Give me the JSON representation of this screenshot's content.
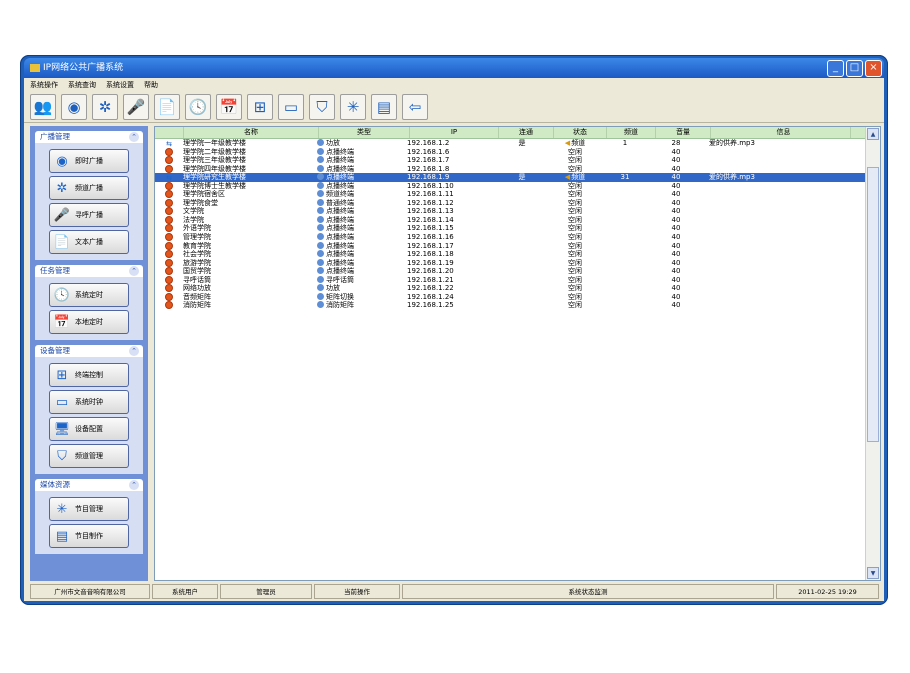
{
  "window": {
    "title": "IP网络公共广播系统"
  },
  "menu": [
    "系统操作",
    "系统查询",
    "系统设置",
    "帮助"
  ],
  "toolbar": [
    {
      "name": "users-icon",
      "glyph": "👥"
    },
    {
      "name": "record-icon",
      "glyph": "◉"
    },
    {
      "name": "snowflake-icon",
      "glyph": "✲"
    },
    {
      "name": "microphone-icon",
      "glyph": "🎤"
    },
    {
      "name": "document-icon",
      "glyph": "📄"
    },
    {
      "name": "clock-icon",
      "glyph": "🕓"
    },
    {
      "name": "schedule-icon",
      "glyph": "📅"
    },
    {
      "name": "network-icon",
      "glyph": "⊞"
    },
    {
      "name": "monitor-icon",
      "glyph": "▭"
    },
    {
      "name": "antenna-icon",
      "glyph": "⛉"
    },
    {
      "name": "burst-icon",
      "glyph": "✳"
    },
    {
      "name": "film-icon",
      "glyph": "▤"
    },
    {
      "name": "exit-icon",
      "glyph": "⇦"
    }
  ],
  "sidebar": {
    "panels": [
      {
        "title": "广播管理",
        "items": [
          {
            "label": "即时广播",
            "icon": "record-icon",
            "glyph": "◉"
          },
          {
            "label": "频道广播",
            "icon": "snowflake-icon",
            "glyph": "✲"
          },
          {
            "label": "寻呼广播",
            "icon": "microphone-icon",
            "glyph": "🎤"
          },
          {
            "label": "文本广播",
            "icon": "document-icon",
            "glyph": "📄"
          }
        ]
      },
      {
        "title": "任务管理",
        "items": [
          {
            "label": "系统定时",
            "icon": "clock-icon",
            "glyph": "🕓"
          },
          {
            "label": "本地定时",
            "icon": "schedule-icon",
            "glyph": "📅"
          }
        ]
      },
      {
        "title": "设备管理",
        "items": [
          {
            "label": "终端控制",
            "icon": "network-icon",
            "glyph": "⊞"
          },
          {
            "label": "系统时钟",
            "icon": "monitor-icon",
            "glyph": "▭"
          },
          {
            "label": "设备配置",
            "icon": "computer-icon",
            "glyph": "🖥"
          },
          {
            "label": "频道管理",
            "icon": "antenna-icon",
            "glyph": "⛉"
          }
        ]
      },
      {
        "title": "媒体资源",
        "items": [
          {
            "label": "节目管理",
            "icon": "burst-icon",
            "glyph": "✳"
          },
          {
            "label": "节目制作",
            "icon": "film-icon",
            "glyph": "▤"
          }
        ]
      }
    ]
  },
  "table": {
    "columns": [
      "",
      "名称",
      "类型",
      "IP",
      "连通",
      "状态",
      "频道",
      "音量",
      "信息"
    ],
    "rows": [
      {
        "icon": "link",
        "name": "理学院一年级教学楼",
        "type": "功放",
        "ip": "192.168.1.2",
        "link": "是",
        "status": "频道",
        "status_icon": "speaker",
        "channel": "1",
        "volume": "28",
        "info": "爱的供养.mp3",
        "selected": false
      },
      {
        "icon": "off",
        "name": "理学院二年级教学楼",
        "type": "点播终端",
        "ip": "192.168.1.6",
        "link": "",
        "status": "空闲",
        "status_icon": "",
        "channel": "",
        "volume": "40",
        "info": "",
        "selected": false
      },
      {
        "icon": "off",
        "name": "理学院三年级教学楼",
        "type": "点播终端",
        "ip": "192.168.1.7",
        "link": "",
        "status": "空闲",
        "status_icon": "",
        "channel": "",
        "volume": "40",
        "info": "",
        "selected": false
      },
      {
        "icon": "off",
        "name": "理学院四年级教学楼",
        "type": "点播终端",
        "ip": "192.168.1.8",
        "link": "",
        "status": "空闲",
        "status_icon": "",
        "channel": "",
        "volume": "40",
        "info": "",
        "selected": false
      },
      {
        "icon": "link",
        "name": "理学院研究生教学楼",
        "type": "点播终端",
        "ip": "192.168.1.9",
        "link": "是",
        "status": "频道",
        "status_icon": "speaker",
        "channel": "31",
        "volume": "40",
        "info": "爱的供养.mp3",
        "selected": true
      },
      {
        "icon": "off",
        "name": "理学院博士生教学楼",
        "type": "点播终端",
        "ip": "192.168.1.10",
        "link": "",
        "status": "空闲",
        "status_icon": "",
        "channel": "",
        "volume": "40",
        "info": "",
        "selected": false
      },
      {
        "icon": "off",
        "name": "理学院宿舍区",
        "type": "频道终端",
        "ip": "192.168.1.11",
        "link": "",
        "status": "空闲",
        "status_icon": "",
        "channel": "",
        "volume": "40",
        "info": "",
        "selected": false
      },
      {
        "icon": "off",
        "name": "理学院食堂",
        "type": "普通终端",
        "ip": "192.168.1.12",
        "link": "",
        "status": "空闲",
        "status_icon": "",
        "channel": "",
        "volume": "40",
        "info": "",
        "selected": false
      },
      {
        "icon": "off",
        "name": "文学院",
        "type": "点播终端",
        "ip": "192.168.1.13",
        "link": "",
        "status": "空闲",
        "status_icon": "",
        "channel": "",
        "volume": "40",
        "info": "",
        "selected": false
      },
      {
        "icon": "off",
        "name": "法学院",
        "type": "点播终端",
        "ip": "192.168.1.14",
        "link": "",
        "status": "空闲",
        "status_icon": "",
        "channel": "",
        "volume": "40",
        "info": "",
        "selected": false
      },
      {
        "icon": "off",
        "name": "外语学院",
        "type": "点播终端",
        "ip": "192.168.1.15",
        "link": "",
        "status": "空闲",
        "status_icon": "",
        "channel": "",
        "volume": "40",
        "info": "",
        "selected": false
      },
      {
        "icon": "off",
        "name": "管理学院",
        "type": "点播终端",
        "ip": "192.168.1.16",
        "link": "",
        "status": "空闲",
        "status_icon": "",
        "channel": "",
        "volume": "40",
        "info": "",
        "selected": false
      },
      {
        "icon": "off",
        "name": "教育学院",
        "type": "点播终端",
        "ip": "192.168.1.17",
        "link": "",
        "status": "空闲",
        "status_icon": "",
        "channel": "",
        "volume": "40",
        "info": "",
        "selected": false
      },
      {
        "icon": "off",
        "name": "社会学院",
        "type": "点播终端",
        "ip": "192.168.1.18",
        "link": "",
        "status": "空闲",
        "status_icon": "",
        "channel": "",
        "volume": "40",
        "info": "",
        "selected": false
      },
      {
        "icon": "off",
        "name": "旅游学院",
        "type": "点播终端",
        "ip": "192.168.1.19",
        "link": "",
        "status": "空闲",
        "status_icon": "",
        "channel": "",
        "volume": "40",
        "info": "",
        "selected": false
      },
      {
        "icon": "off",
        "name": "国贸学院",
        "type": "点播终端",
        "ip": "192.168.1.20",
        "link": "",
        "status": "空闲",
        "status_icon": "",
        "channel": "",
        "volume": "40",
        "info": "",
        "selected": false
      },
      {
        "icon": "off",
        "name": "寻呼话筒",
        "type": "寻呼话筒",
        "ip": "192.168.1.21",
        "link": "",
        "status": "空闲",
        "status_icon": "",
        "channel": "",
        "volume": "40",
        "info": "",
        "selected": false
      },
      {
        "icon": "off",
        "name": "网络功放",
        "type": "功放",
        "ip": "192.168.1.22",
        "link": "",
        "status": "空闲",
        "status_icon": "",
        "channel": "",
        "volume": "40",
        "info": "",
        "selected": false
      },
      {
        "icon": "off",
        "name": "音频矩阵",
        "type": "矩阵切换",
        "ip": "192.168.1.24",
        "link": "",
        "status": "空闲",
        "status_icon": "",
        "channel": "",
        "volume": "40",
        "info": "",
        "selected": false
      },
      {
        "icon": "off",
        "name": "消防矩阵",
        "type": "消防矩阵",
        "ip": "192.168.1.25",
        "link": "",
        "status": "空闲",
        "status_icon": "",
        "channel": "",
        "volume": "40",
        "info": "",
        "selected": false
      }
    ]
  },
  "statusbar": {
    "company": "广州市文音音响有限公司",
    "user_label": "系统用户",
    "user": "管理员",
    "op_label": "当前操作",
    "monitor": "系统状态监测",
    "datetime": "2011-02-25 19:29"
  },
  "colors": {
    "selection": "#3167c6",
    "window_frame": "#1f5fb8",
    "header": "#cfeac4"
  }
}
